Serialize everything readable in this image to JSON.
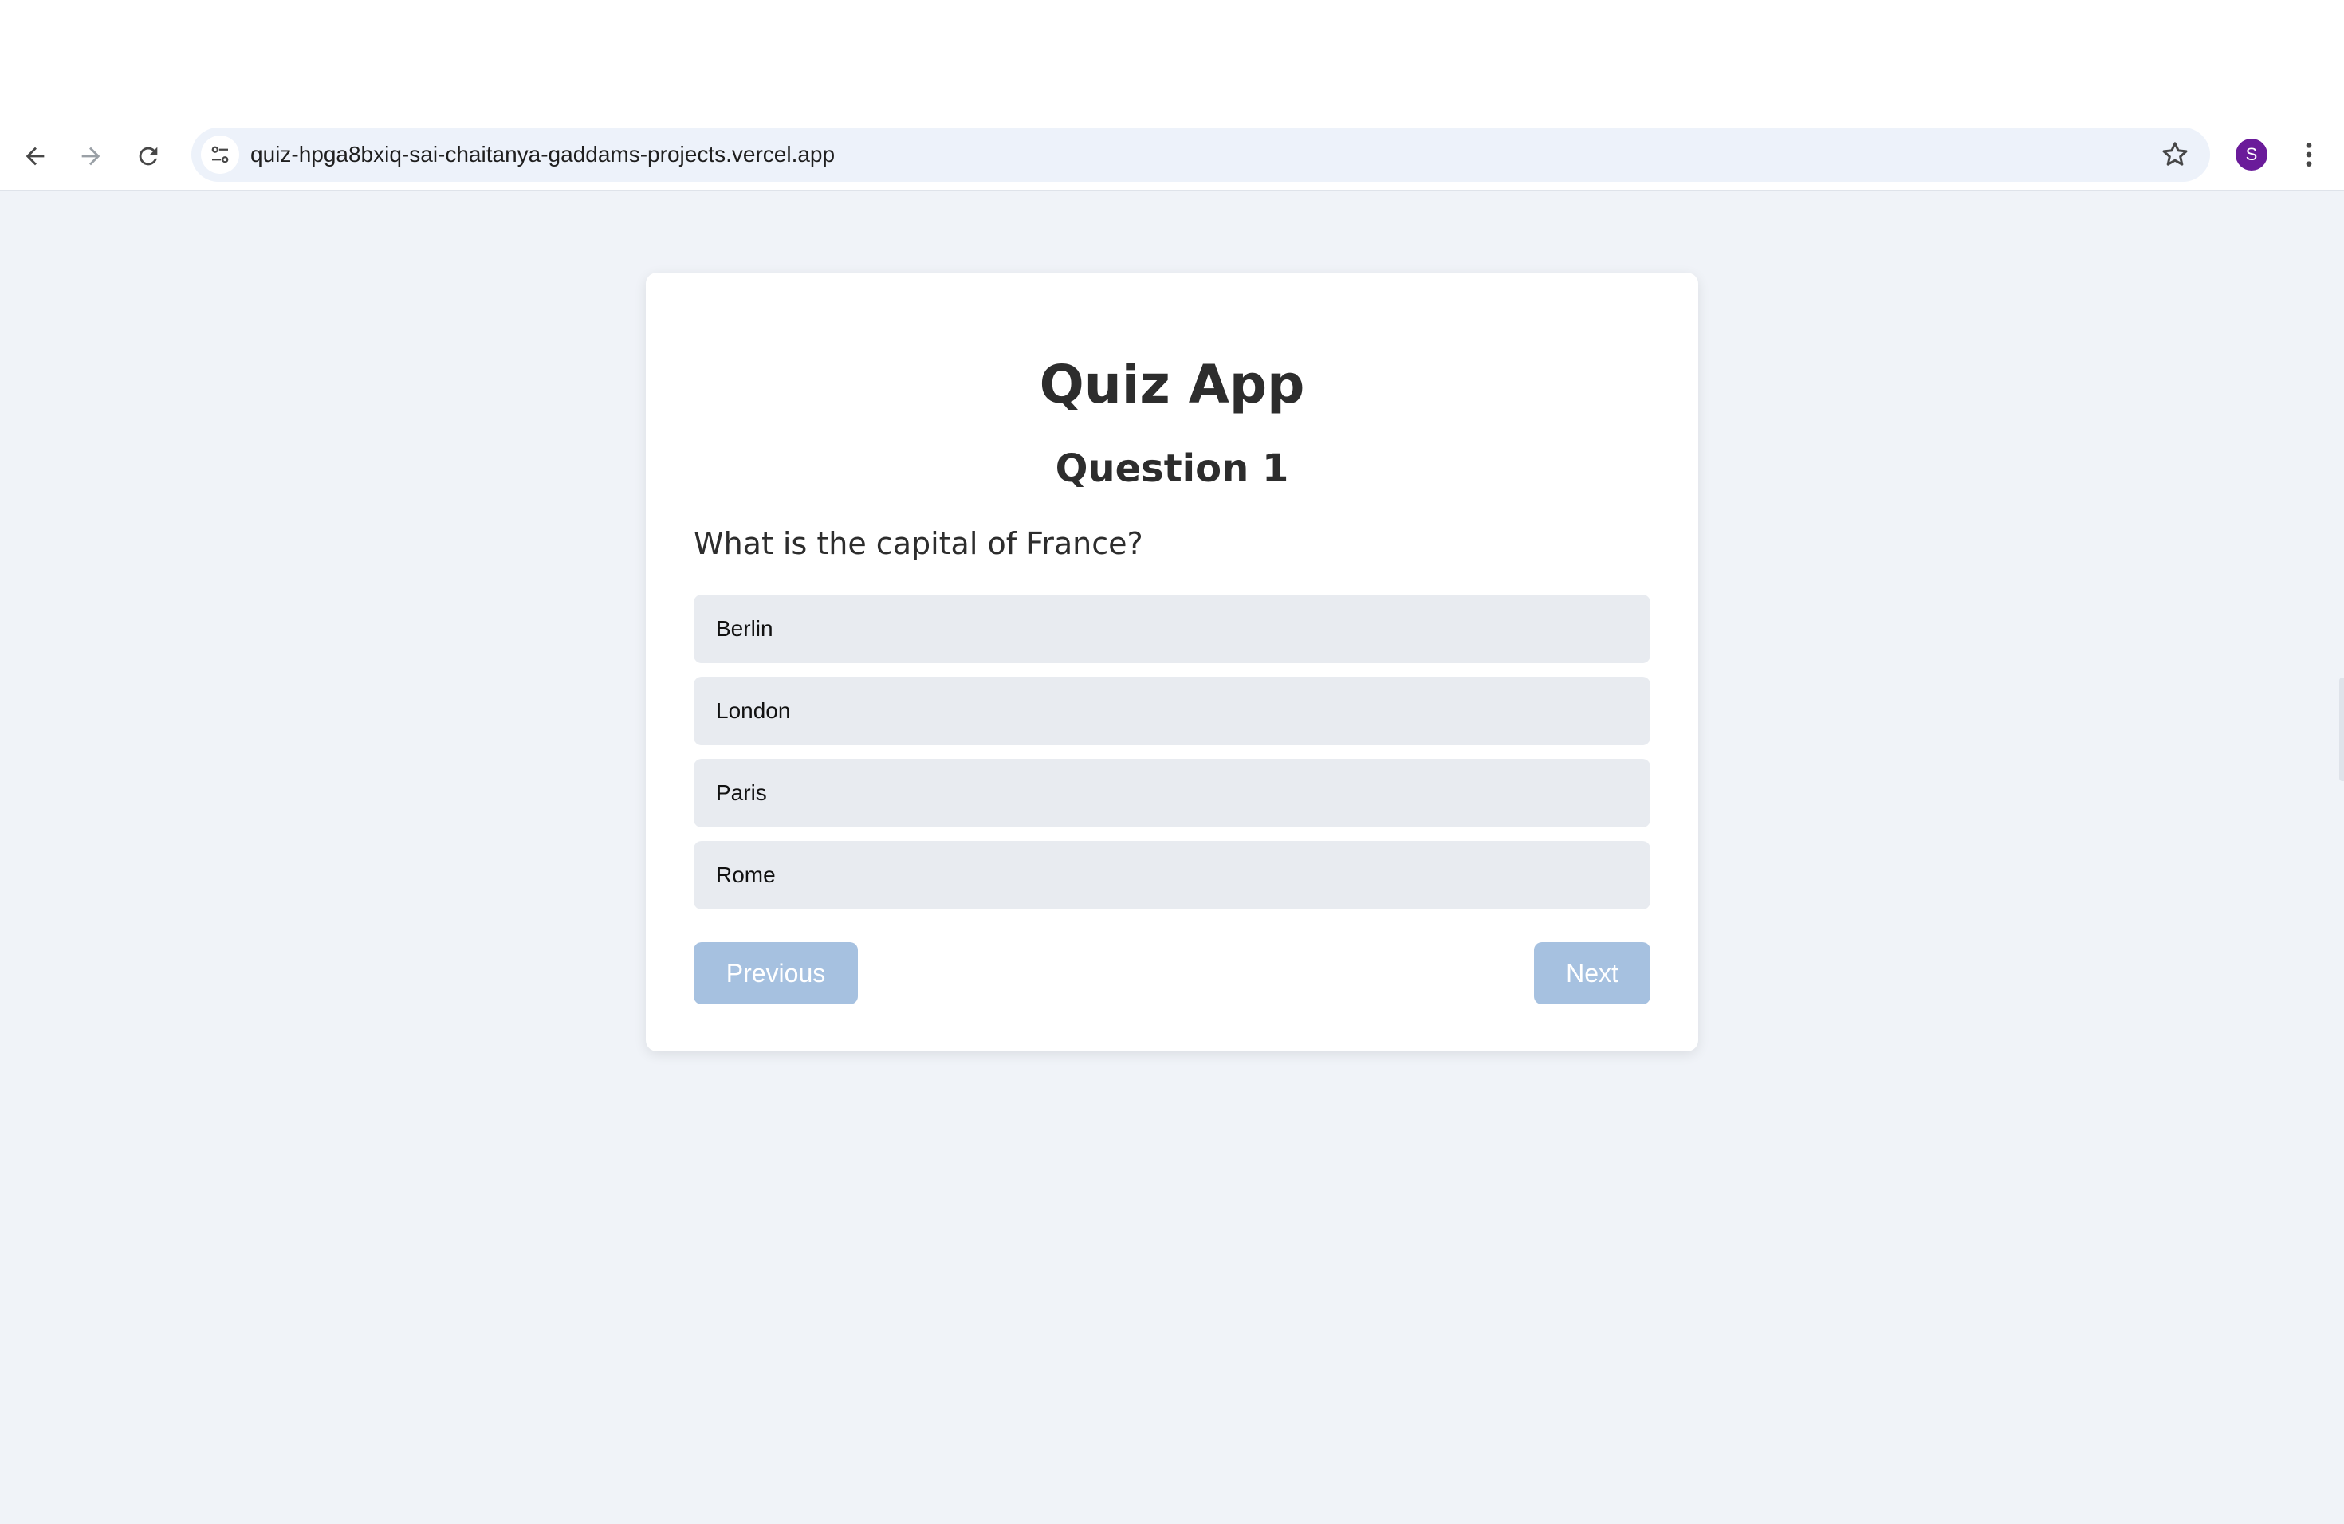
{
  "browser": {
    "url": "quiz-hpga8bxiq-sai-chaitanya-gaddams-projects.vercel.app",
    "profile_initial": "S",
    "profile_color": "#6a1b9a",
    "icons": [
      "back-icon",
      "forward-icon",
      "reload-icon",
      "site-info-icon",
      "bookmark-star-icon",
      "more-menu-icon"
    ]
  },
  "quiz": {
    "title": "Quiz App",
    "question_heading": "Question 1",
    "question_text": "What is the capital of France?",
    "options": [
      "Berlin",
      "London",
      "Paris",
      "Rome"
    ],
    "previous_label": "Previous",
    "next_label": "Next"
  },
  "colors": {
    "page_background": "#f0f3f8",
    "option_background": "#e8ebf0",
    "button_disabled": "#a6c1e0"
  }
}
